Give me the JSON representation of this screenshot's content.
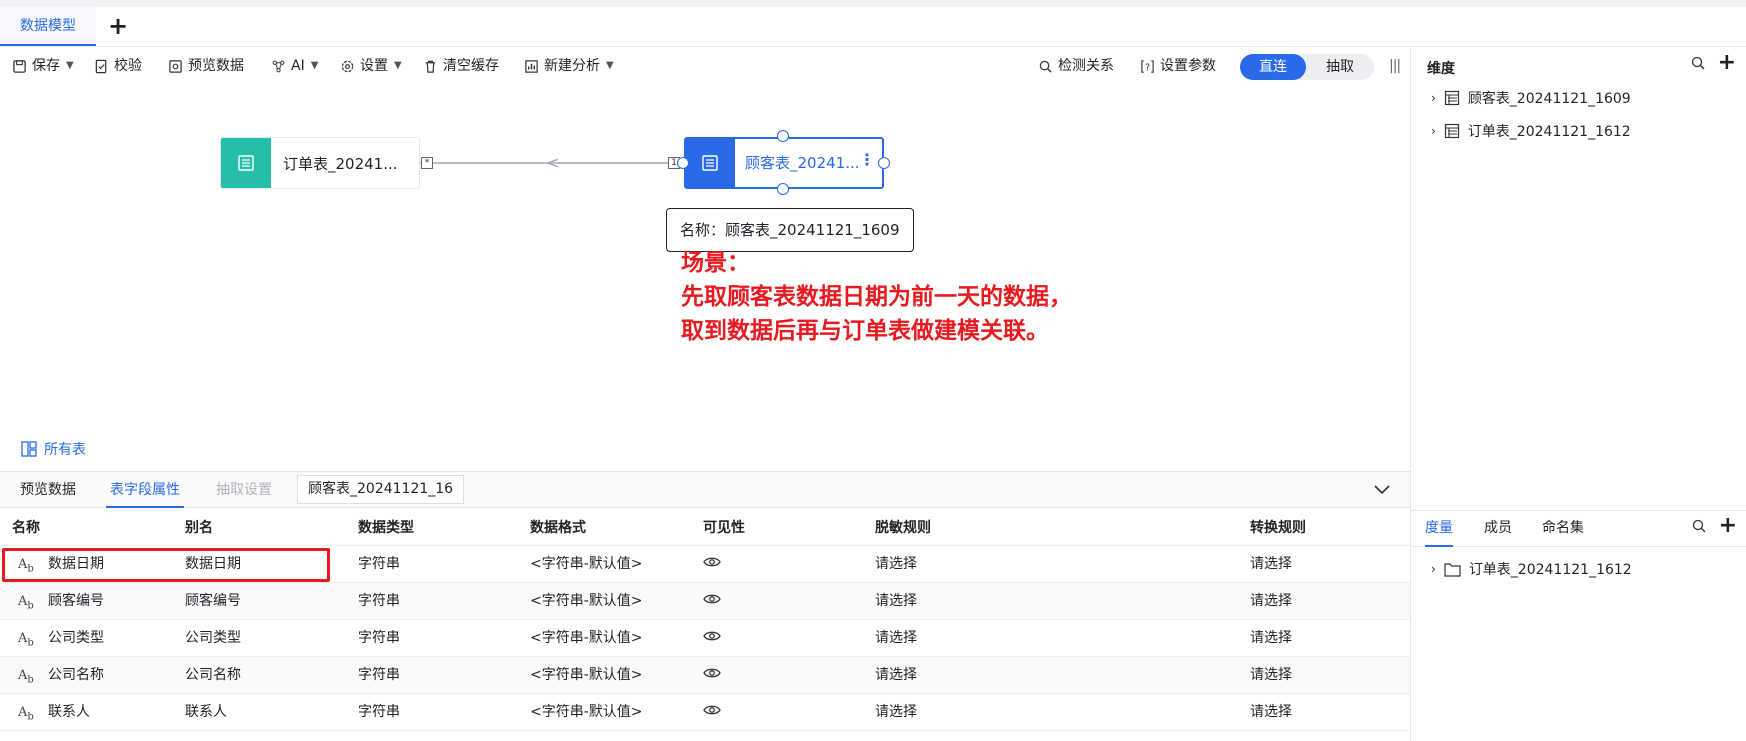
{
  "tabs": {
    "active": "数据模型",
    "add": "+"
  },
  "toolbar": {
    "save": "保存",
    "validate": "校验",
    "preview": "预览数据",
    "ai": "AI",
    "settings": "设置",
    "clear_cache": "清空缓存",
    "new_analysis": "新建分析",
    "detect_relation": "检测关系",
    "set_params": "设置参数",
    "mode_direct": "直连",
    "mode_extract": "抽取"
  },
  "canvas": {
    "node_orders": "订单表_20241...",
    "node_customers": "顾客表_20241...",
    "edge_left_mark": "*",
    "edge_right_mark": "1",
    "tooltip": "名称：顾客表_20241121_1609",
    "callout_line1": "场景：",
    "callout_line2": "先取顾客表数据日期为前一天的数据，",
    "callout_line3": "取到数据后再与订单表做建模关联。",
    "all_tables": "所有表"
  },
  "bottom": {
    "tab_preview": "预览数据",
    "tab_fields": "表字段属性",
    "tab_extract": "抽取设置",
    "table_select": "顾客表_20241121_16",
    "columns": [
      "名称",
      "别名",
      "数据类型",
      "数据格式",
      "可见性",
      "脱敏规则",
      "转换规则"
    ],
    "rows": [
      {
        "name": "数据日期",
        "alias": "数据日期",
        "type": "字符串",
        "format": "<字符串-默认值>",
        "mask": "请选择",
        "convert": "请选择"
      },
      {
        "name": "顾客编号",
        "alias": "顾客编号",
        "type": "字符串",
        "format": "<字符串-默认值>",
        "mask": "请选择",
        "convert": "请选择"
      },
      {
        "name": "公司类型",
        "alias": "公司类型",
        "type": "字符串",
        "format": "<字符串-默认值>",
        "mask": "请选择",
        "convert": "请选择"
      },
      {
        "name": "公司名称",
        "alias": "公司名称",
        "type": "字符串",
        "format": "<字符串-默认值>",
        "mask": "请选择",
        "convert": "请选择"
      },
      {
        "name": "联系人",
        "alias": "联系人",
        "type": "字符串",
        "format": "<字符串-默认值>",
        "mask": "请选择",
        "convert": "请选择"
      }
    ]
  },
  "right": {
    "dimension_title": "维度",
    "dim_items": [
      "顾客表_20241121_1609",
      "订单表_20241121_1612"
    ],
    "tab_measure": "度量",
    "tab_members": "成员",
    "tab_named_sets": "命名集",
    "measure_items": [
      "订单表_20241121_1612"
    ]
  },
  "colors": {
    "accent": "#2a6ae9",
    "teal": "#25bfa9",
    "callout": "#e8191f"
  }
}
